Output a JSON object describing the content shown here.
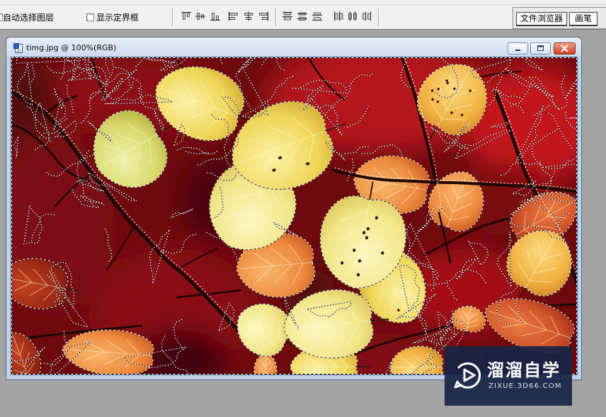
{
  "options_bar": {
    "auto_select_layer": {
      "label": "自动选择图层",
      "checked": false
    },
    "show_bounding_box": {
      "label": "显示定界框",
      "checked": false
    },
    "align_icons": [
      "align-top-edges-icon",
      "align-vertical-centers-icon",
      "align-bottom-edges-icon",
      "align-left-edges-icon",
      "align-horizontal-centers-icon",
      "align-right-edges-icon"
    ],
    "distribute_icons": [
      "distribute-top-edges-icon",
      "distribute-vertical-centers-icon",
      "distribute-bottom-edges-icon",
      "distribute-left-edges-icon",
      "distribute-horizontal-centers-icon",
      "distribute-right-edges-icon"
    ]
  },
  "palette_well": {
    "tabs": [
      {
        "label": "文件浏览器"
      },
      {
        "label": "画笔"
      }
    ]
  },
  "document_window": {
    "title": "timg.jpg @ 100%(RGB)",
    "icons": [
      "document-icon",
      "minimize-icon",
      "maximize-icon",
      "close-icon"
    ]
  },
  "watermark": {
    "brand": "溜溜自学",
    "site": "ZIXUE.3D66.COM",
    "icon": "play-logo-icon"
  },
  "colors": {
    "workspace": "#a3a3a3",
    "title_bar": "#cdd9ec",
    "close_button": "#d33c22",
    "watermark_bg": "#182546",
    "photo_background": "#6e0a0e"
  }
}
